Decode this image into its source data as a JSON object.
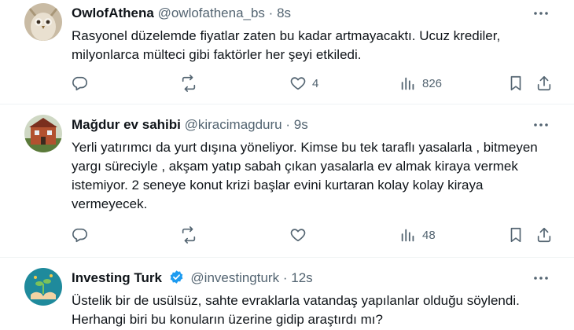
{
  "tweets": [
    {
      "name": "OwlofAthena",
      "handle": "@owlofathena_bs",
      "sep": "·",
      "time": "8s",
      "verified": false,
      "text": "Rasyonel düzelemde fiyatlar zaten bu kadar artmayacaktı. Ucuz krediler, milyonlarca mülteci gibi faktörler her şeyi etkiledi.",
      "replies": "",
      "retweets": "",
      "likes": "4",
      "views": "826"
    },
    {
      "name": "Mağdur ev sahibi",
      "handle": "@kiracimagduru",
      "sep": "·",
      "time": "9s",
      "verified": false,
      "text": "Yerli yatırımcı da yurt dışına yöneliyor. Kimse bu tek taraflı yasalarla , bitmeyen yargı süreciyle , akşam yatıp sabah çıkan yasalarla ev almak kiraya vermek istemiyor. 2 seneye konut krizi başlar evini kurtaran kolay kolay kiraya vermeyecek.",
      "replies": "",
      "retweets": "",
      "likes": "",
      "views": "48"
    },
    {
      "name": "Investing Turk",
      "handle": "@investingturk",
      "sep": "·",
      "time": "12s",
      "verified": true,
      "text": "Üstelik bir de usülsüz, sahte evraklarla vatandaş yapılanlar olduğu söylendi. Herhangi biri bu konuların üzerine gidip araştırdı mı?"
    }
  ],
  "colors": {
    "text": "#0f1419",
    "secondary": "#536471",
    "divider": "#eff3f4",
    "verified": "#1d9bf0"
  }
}
